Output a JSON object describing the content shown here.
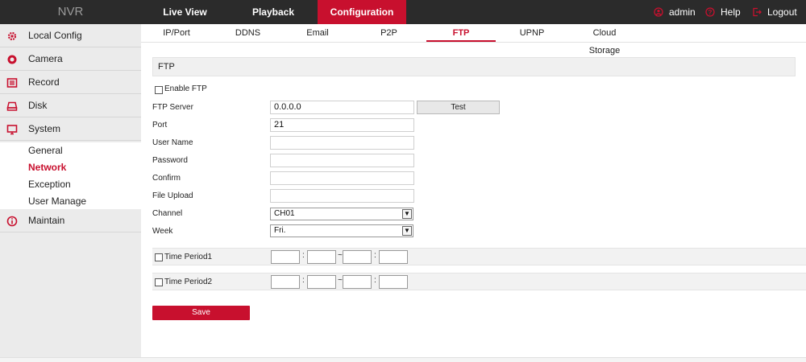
{
  "header": {
    "logo": "NVR",
    "nav": [
      "Live View",
      "Playback",
      "Configuration"
    ],
    "active_nav": "Configuration",
    "user": "admin",
    "help": "Help",
    "logout": "Logout"
  },
  "sidebar": {
    "items": [
      "Local Config",
      "Camera",
      "Record",
      "Disk",
      "System"
    ],
    "sub_items": [
      "General",
      "Network",
      "Exception",
      "User Manage"
    ],
    "active_sub": "Network",
    "maintain": "Maintain"
  },
  "tabs": [
    "IP/Port",
    "DDNS",
    "Email",
    "P2P",
    "FTP",
    "UPNP",
    "Cloud Storage"
  ],
  "active_tab": "FTP",
  "form": {
    "section_title": "FTP",
    "enable_label": "Enable FTP",
    "server_label": "FTP Server",
    "server_value": "0.0.0.0",
    "test_label": "Test",
    "port_label": "Port",
    "port_value": "21",
    "user_label": "User Name",
    "user_value": "",
    "password_label": "Password",
    "password_value": "",
    "confirm_label": "Confirm",
    "confirm_value": "",
    "upload_label": "File Upload",
    "upload_value": "",
    "channel_label": "Channel",
    "channel_value": "CH01",
    "week_label": "Week",
    "week_value": "Fri.",
    "period1_label": "Time Period1",
    "period2_label": "Time Period2",
    "colon": ":",
    "tilde": "~",
    "save_label": "Save"
  },
  "colors": {
    "accent": "#c8102e",
    "topbar": "#2b2b2b",
    "sidebar": "#ebebeb"
  }
}
